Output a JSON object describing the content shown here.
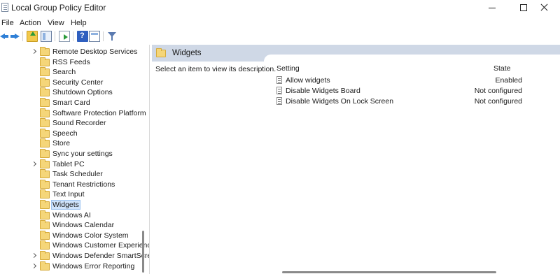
{
  "window": {
    "title": "Local Group Policy Editor",
    "icon": "document-list-icon"
  },
  "menu": [
    {
      "label": "File"
    },
    {
      "label": "Action"
    },
    {
      "label": "View"
    },
    {
      "label": "Help"
    }
  ],
  "toolbar": [
    {
      "icon": "back-arrow-icon"
    },
    {
      "icon": "forward-arrow-icon"
    },
    {
      "icon": "up-folder-icon"
    },
    {
      "icon": "show-hide-tree-icon"
    },
    {
      "icon": "export-list-icon"
    },
    {
      "icon": "help-icon"
    },
    {
      "icon": "properties-icon"
    },
    {
      "icon": "filter-icon"
    }
  ],
  "tree": {
    "items": [
      {
        "label": "Remote Desktop Services",
        "expandable": true
      },
      {
        "label": "RSS Feeds",
        "expandable": false
      },
      {
        "label": "Search",
        "expandable": false
      },
      {
        "label": "Security Center",
        "expandable": false
      },
      {
        "label": "Shutdown Options",
        "expandable": false
      },
      {
        "label": "Smart Card",
        "expandable": false
      },
      {
        "label": "Software Protection Platform",
        "expandable": false
      },
      {
        "label": "Sound Recorder",
        "expandable": false
      },
      {
        "label": "Speech",
        "expandable": false
      },
      {
        "label": "Store",
        "expandable": false
      },
      {
        "label": "Sync your settings",
        "expandable": false
      },
      {
        "label": "Tablet PC",
        "expandable": true
      },
      {
        "label": "Task Scheduler",
        "expandable": false
      },
      {
        "label": "Tenant Restrictions",
        "expandable": false
      },
      {
        "label": "Text Input",
        "expandable": false
      },
      {
        "label": "Widgets",
        "expandable": false,
        "selected": true
      },
      {
        "label": "Windows AI",
        "expandable": false
      },
      {
        "label": "Windows Calendar",
        "expandable": false
      },
      {
        "label": "Windows Color System",
        "expandable": false
      },
      {
        "label": "Windows Customer Experienc",
        "expandable": false
      },
      {
        "label": "Windows Defender SmartScre",
        "expandable": true
      },
      {
        "label": "Windows Error Reporting",
        "expandable": true
      }
    ]
  },
  "details": {
    "folder_title": "Widgets",
    "description": "Select an item to view its description.",
    "columns": {
      "setting": "Setting",
      "state": "State"
    },
    "rows": [
      {
        "name": "Allow widgets",
        "state": "Enabled"
      },
      {
        "name": "Disable Widgets Board",
        "state": "Not configured"
      },
      {
        "name": "Disable Widgets On Lock Screen",
        "state": "Not configured"
      }
    ]
  }
}
